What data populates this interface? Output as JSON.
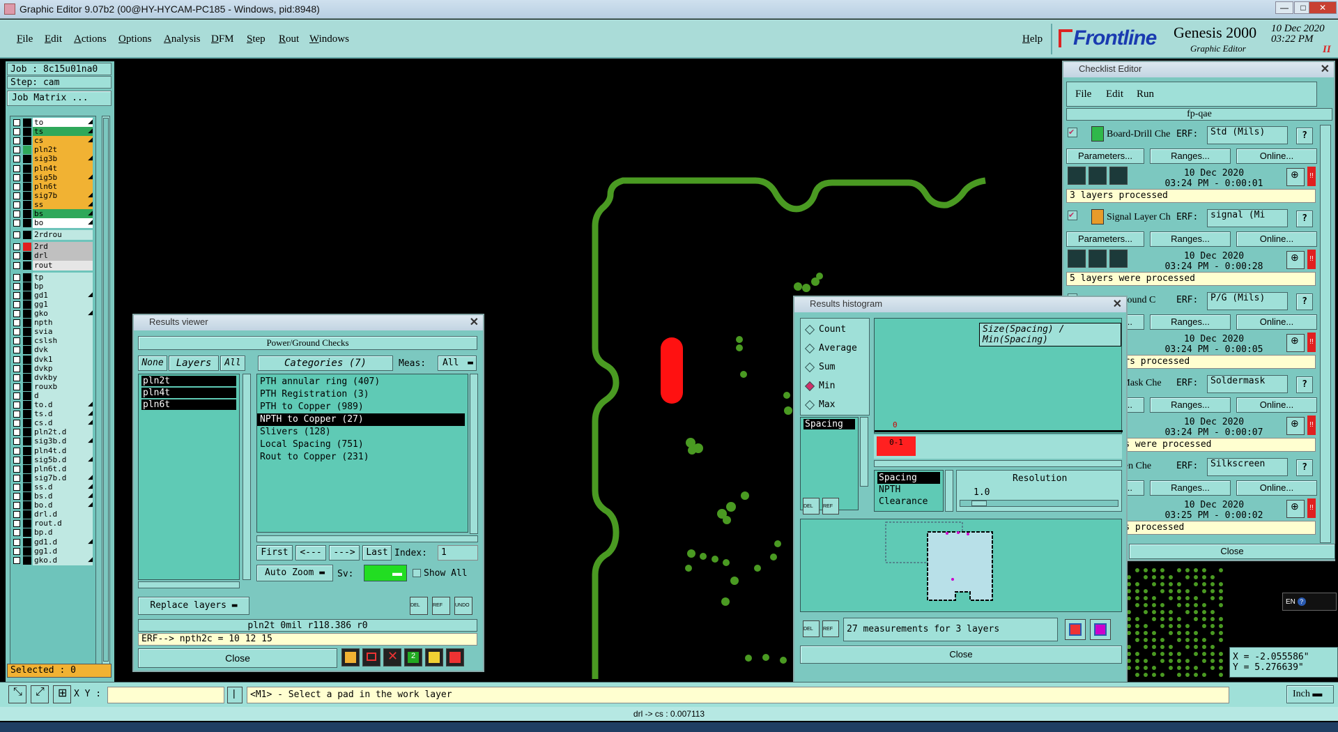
{
  "window": {
    "title": "Graphic Editor 9.07b2 (00@HY-HYCAM-PC185 - Windows, pid:8948)",
    "min": "—",
    "max": "□",
    "close": "✕"
  },
  "menu": {
    "file": "File",
    "edit": "Edit",
    "actions": "Actions",
    "options": "Options",
    "analysis": "Analysis",
    "dfm": "DFM",
    "step": "Step",
    "rout": "Rout",
    "windows": "Windows",
    "help": "Help"
  },
  "brand": {
    "name": "Frontline",
    "product": "Genesis 2000",
    "subtitle": "Graphic Editor",
    "date": "10 Dec 2020",
    "time": "03:22 PM",
    "pause": "II"
  },
  "job": {
    "job_label": "Job : 8c15u01na0",
    "step_label": "Step: cam",
    "matrix_button": "Job Matrix ...",
    "selected": "Selected : 0"
  },
  "layers": [
    {
      "name": "to",
      "color": "#ffffff",
      "arrow": "◢",
      "mark": "#000000"
    },
    {
      "name": "ts",
      "color": "#2fa85a",
      "arrow": "◢",
      "mark": "#000000"
    },
    {
      "name": "cs",
      "color": "#f1b233",
      "arrow": "◢",
      "mark": "#000000"
    },
    {
      "name": "pln2t",
      "color": "#f1b233",
      "arrow": "",
      "mark": "#2fa85a"
    },
    {
      "name": "sig3b",
      "color": "#f1b233",
      "arrow": "◢",
      "mark": "#000000"
    },
    {
      "name": "pln4t",
      "color": "#f1b233",
      "arrow": "",
      "mark": "#000000"
    },
    {
      "name": "sig5b",
      "color": "#f1b233",
      "arrow": "◢",
      "mark": "#000000"
    },
    {
      "name": "pln6t",
      "color": "#f1b233",
      "arrow": "",
      "mark": "#000000"
    },
    {
      "name": "sig7b",
      "color": "#f1b233",
      "arrow": "◢",
      "mark": "#000000"
    },
    {
      "name": "ss",
      "color": "#f1b233",
      "arrow": "◢",
      "mark": "#000000"
    },
    {
      "name": "bs",
      "color": "#2fa85a",
      "arrow": "◢",
      "mark": "#000000"
    },
    {
      "name": "bo",
      "color": "#ffffff",
      "arrow": "◢",
      "mark": "#000000"
    },
    {
      "name": "2rdrou",
      "color": "#bfe8e2",
      "arrow": "",
      "mark": "#000000"
    },
    {
      "name": "2rd",
      "color": "#c0c0c0",
      "arrow": "",
      "mark": "#e02020"
    },
    {
      "name": "drl",
      "color": "#c0c0c0",
      "arrow": "",
      "mark": "#000000"
    },
    {
      "name": "rout",
      "color": "#e6e6e6",
      "arrow": "",
      "mark": "#000000"
    },
    {
      "name": "tp",
      "color": "#bfe8e2",
      "arrow": "",
      "mark": "#000000"
    },
    {
      "name": "bp",
      "color": "#bfe8e2",
      "arrow": "",
      "mark": "#000000"
    },
    {
      "name": "gd1",
      "color": "#bfe8e2",
      "arrow": "◢",
      "mark": "#000000"
    },
    {
      "name": "gg1",
      "color": "#bfe8e2",
      "arrow": "",
      "mark": "#000000"
    },
    {
      "name": "gko",
      "color": "#bfe8e2",
      "arrow": "◢",
      "mark": "#000000"
    },
    {
      "name": "npth",
      "color": "#bfe8e2",
      "arrow": "",
      "mark": "#000000"
    },
    {
      "name": "svia",
      "color": "#bfe8e2",
      "arrow": "",
      "mark": "#000000"
    },
    {
      "name": "cslsh",
      "color": "#bfe8e2",
      "arrow": "",
      "mark": "#000000"
    },
    {
      "name": "dvk",
      "color": "#bfe8e2",
      "arrow": "",
      "mark": "#000000"
    },
    {
      "name": "dvk1",
      "color": "#bfe8e2",
      "arrow": "",
      "mark": "#000000"
    },
    {
      "name": "dvkp",
      "color": "#bfe8e2",
      "arrow": "",
      "mark": "#000000"
    },
    {
      "name": "dvkby",
      "color": "#bfe8e2",
      "arrow": "",
      "mark": "#000000"
    },
    {
      "name": "rouxb",
      "color": "#bfe8e2",
      "arrow": "",
      "mark": "#000000"
    },
    {
      "name": "d",
      "color": "#bfe8e2",
      "arrow": "",
      "mark": "#000000"
    },
    {
      "name": "to.d",
      "color": "#bfe8e2",
      "arrow": "◢",
      "mark": "#000000"
    },
    {
      "name": "ts.d",
      "color": "#bfe8e2",
      "arrow": "◢",
      "mark": "#000000"
    },
    {
      "name": "cs.d",
      "color": "#bfe8e2",
      "arrow": "◢",
      "mark": "#000000"
    },
    {
      "name": "pln2t.d",
      "color": "#bfe8e2",
      "arrow": "",
      "mark": "#000000"
    },
    {
      "name": "sig3b.d",
      "color": "#bfe8e2",
      "arrow": "◢",
      "mark": "#000000"
    },
    {
      "name": "pln4t.d",
      "color": "#bfe8e2",
      "arrow": "",
      "mark": "#000000"
    },
    {
      "name": "sig5b.d",
      "color": "#bfe8e2",
      "arrow": "◢",
      "mark": "#000000"
    },
    {
      "name": "pln6t.d",
      "color": "#bfe8e2",
      "arrow": "",
      "mark": "#000000"
    },
    {
      "name": "sig7b.d",
      "color": "#bfe8e2",
      "arrow": "◢",
      "mark": "#000000"
    },
    {
      "name": "ss.d",
      "color": "#bfe8e2",
      "arrow": "◢",
      "mark": "#000000"
    },
    {
      "name": "bs.d",
      "color": "#bfe8e2",
      "arrow": "◢",
      "mark": "#000000"
    },
    {
      "name": "bo.d",
      "color": "#bfe8e2",
      "arrow": "◢",
      "mark": "#000000"
    },
    {
      "name": "drl.d",
      "color": "#bfe8e2",
      "arrow": "",
      "mark": "#000000"
    },
    {
      "name": "rout.d",
      "color": "#bfe8e2",
      "arrow": "",
      "mark": "#000000"
    },
    {
      "name": "bp.d",
      "color": "#bfe8e2",
      "arrow": "",
      "mark": "#000000"
    },
    {
      "name": "gd1.d",
      "color": "#bfe8e2",
      "arrow": "◢",
      "mark": "#000000"
    },
    {
      "name": "gg1.d",
      "color": "#bfe8e2",
      "arrow": "",
      "mark": "#000000"
    },
    {
      "name": "gko.d",
      "color": "#bfe8e2",
      "arrow": "◢",
      "mark": "#000000"
    }
  ],
  "results_viewer": {
    "title": "Results viewer",
    "header": "Power/Ground Checks",
    "none": "None",
    "layers_tab": "Layers",
    "all": "All",
    "categories_tab": "Categories (7)",
    "meas_label": "Meas:",
    "meas_value": "All",
    "layer_items": [
      "pln2t",
      "pln4t",
      "pln6t"
    ],
    "categories": [
      "PTH annular ring (407)",
      "PTH Registration (3)",
      "PTH to Copper (989)",
      "NPTH to Copper (27)",
      "Slivers (128)",
      "Local Spacing (751)",
      "Rout to Copper (231)"
    ],
    "selected_category": "NPTH to Copper (27)",
    "first": "First",
    "prev": "<---",
    "next": "--->",
    "last": "Last",
    "index_label": "Index:",
    "index_value": "1",
    "auto_zoom": "Auto Zoom",
    "sv_label": "Sv:",
    "show_all": "Show All",
    "replace_layers": "Replace layers",
    "info_line": "pln2t 0mil   r118.386  r0",
    "erf_line": "ERF--> npth2c = 10 12 15",
    "close": "Close"
  },
  "histogram": {
    "title": "Results histogram",
    "header": "Size(Spacing) / Min(Spacing)",
    "options": [
      "Count",
      "Average",
      "Sum",
      "Min",
      "Max"
    ],
    "selected_option": "Min",
    "field_items": [
      "Spacing"
    ],
    "zero_label": "0",
    "bin_label": "0-1",
    "type_items": [
      "Spacing",
      "NPTH",
      "Clearance"
    ],
    "resolution_label": "Resolution",
    "resolution_value": "1.0",
    "footer": "27 measurements for 3 layers",
    "close": "Close"
  },
  "checklist": {
    "title": "Checklist Editor",
    "menu": [
      "File",
      "Edit",
      "Run"
    ],
    "name": "fp-qae",
    "erf_label": "ERF:",
    "parameters": "Parameters...",
    "ranges": "Ranges...",
    "online": "Online...",
    "sections": [
      {
        "name": "Board-Drill Che",
        "erf": "Std (Mils)",
        "date": "10 Dec 2020",
        "time": "03:24 PM - 0:00:01",
        "result": "3 layers processed",
        "color": "#2fb84a"
      },
      {
        "name": "Signal Layer Ch",
        "erf": "signal (Mi",
        "date": "10 Dec 2020",
        "time": "03:24 PM - 0:00:28",
        "result": "5 layers were processed",
        "color": "#e89b2a"
      },
      {
        "name": "er/Ground C",
        "erf": "P/G (Mils)",
        "date": "10 Dec 2020",
        "time": "03:24 PM - 0:00:05",
        "result": "round layers processed",
        "color": ""
      },
      {
        "name": "der Mask Che",
        "erf": "Soldermask",
        "date": "10 Dec 2020",
        "time": "03:24 PM - 0:00:07",
        "result": "Mask layers were processed",
        "color": ""
      },
      {
        "name": "Screen Che",
        "erf": "Silkscreen",
        "date": "10 Dec 2020",
        "time": "03:25 PM - 0:00:02",
        "result": "reen layers processed",
        "color": ""
      }
    ],
    "close": "Close"
  },
  "statusbar": {
    "xy_label": "X Y :",
    "xy_value": "",
    "prompt": "<M1> - Select a pad in the work layer",
    "unit": "Inch",
    "coord_x": "X = -2.055586\"",
    "coord_y": "Y =  5.276639\"",
    "lang": "EN"
  },
  "infobar": {
    "text": "drl -> cs : 0.007113"
  }
}
